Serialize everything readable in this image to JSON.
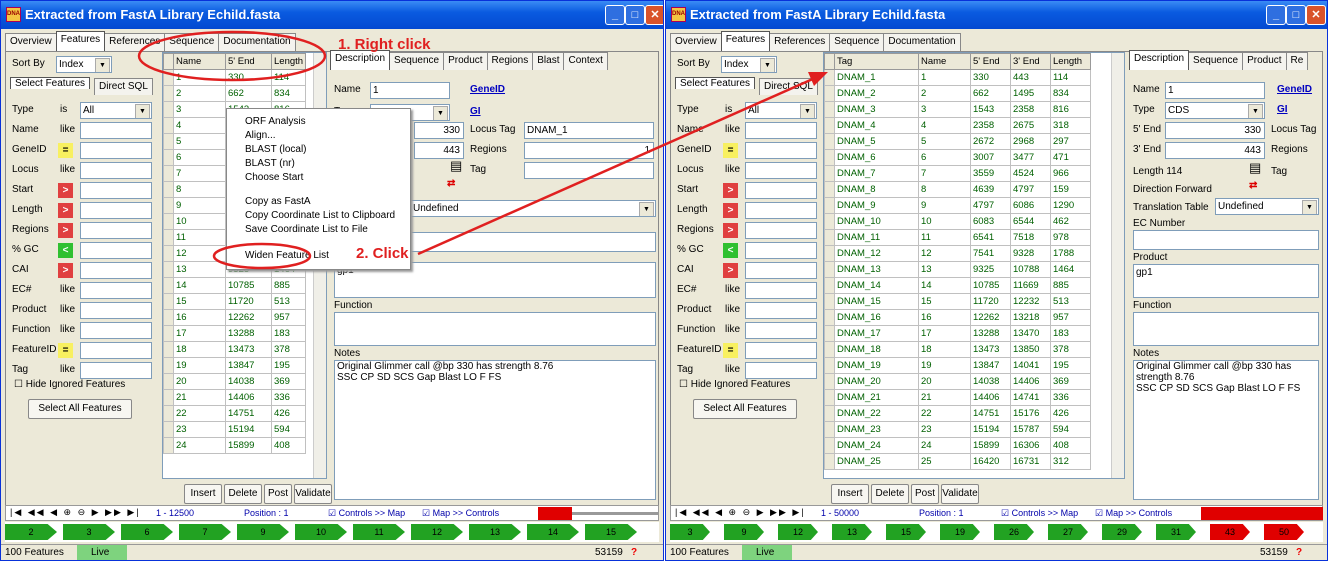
{
  "window_title": "Extracted from FastA Library Echild.fasta",
  "title_icon": "DNA",
  "title_buttons": [
    "_",
    "□",
    "✕"
  ],
  "main_tabs": [
    "Overview",
    "Features",
    "References",
    "Sequence",
    "Documentation"
  ],
  "sort_by": {
    "label": "Sort By",
    "value": "Index"
  },
  "filter_tabs": [
    "Select Features",
    "Direct SQL"
  ],
  "filters": [
    {
      "label": "Type",
      "op_text": "is",
      "value": "All"
    },
    {
      "label": "Name",
      "op_text": "like"
    },
    {
      "label": "GeneID",
      "op_sym": "="
    },
    {
      "label": "Locus",
      "op_text": "like"
    },
    {
      "label": "Start",
      "op_sym": ">"
    },
    {
      "label": "Length",
      "op_sym": ">"
    },
    {
      "label": "Regions",
      "op_sym": ">"
    },
    {
      "label": "% GC",
      "op_sym": "<"
    },
    {
      "label": "CAI",
      "op_sym": ">"
    },
    {
      "label": "EC#",
      "op_text": "like"
    },
    {
      "label": "Product",
      "op_text": "like"
    },
    {
      "label": "Function",
      "op_text": "like"
    },
    {
      "label": "FeatureID",
      "op_sym": "="
    },
    {
      "label": "Tag",
      "op_text": "like"
    }
  ],
  "hide_ignored_label": "Hide Ignored Features",
  "select_all_label": "Select All Features",
  "grid_headers_left": [
    "Name",
    "5' End",
    "Length"
  ],
  "grid_headers_right": [
    "Tag",
    "Name",
    "5' End",
    "3' End",
    "Length"
  ],
  "rows": [
    [
      "DNAM_1",
      "1",
      "330",
      "443",
      "114"
    ],
    [
      "DNAM_2",
      "2",
      "662",
      "1495",
      "834"
    ],
    [
      "DNAM_3",
      "3",
      "1543",
      "2358",
      "816"
    ],
    [
      "DNAM_4",
      "4",
      "2358",
      "2675",
      "318"
    ],
    [
      "DNAM_5",
      "5",
      "2672",
      "2968",
      "297"
    ],
    [
      "DNAM_6",
      "6",
      "3007",
      "3477",
      "471"
    ],
    [
      "DNAM_7",
      "7",
      "3559",
      "4524",
      "966"
    ],
    [
      "DNAM_8",
      "8",
      "4639",
      "4797",
      "159"
    ],
    [
      "DNAM_9",
      "9",
      "4797",
      "6086",
      "1290"
    ],
    [
      "DNAM_10",
      "10",
      "6083",
      "6544",
      "462"
    ],
    [
      "DNAM_11",
      "11",
      "6541",
      "7518",
      "978"
    ],
    [
      "DNAM_12",
      "12",
      "7541",
      "9328",
      "1788"
    ],
    [
      "DNAM_13",
      "13",
      "9325",
      "10788",
      "1464"
    ],
    [
      "DNAM_14",
      "14",
      "10785",
      "11669",
      "885"
    ],
    [
      "DNAM_15",
      "15",
      "11720",
      "12232",
      "513"
    ],
    [
      "DNAM_16",
      "16",
      "12262",
      "13218",
      "957"
    ],
    [
      "DNAM_17",
      "17",
      "13288",
      "13470",
      "183"
    ],
    [
      "DNAM_18",
      "18",
      "13473",
      "13850",
      "378"
    ],
    [
      "DNAM_19",
      "19",
      "13847",
      "14041",
      "195"
    ],
    [
      "DNAM_20",
      "20",
      "14038",
      "14406",
      "369"
    ],
    [
      "DNAM_21",
      "21",
      "14406",
      "14741",
      "336"
    ],
    [
      "DNAM_22",
      "22",
      "14751",
      "15176",
      "426"
    ],
    [
      "DNAM_23",
      "23",
      "15194",
      "15787",
      "594"
    ],
    [
      "DNAM_24",
      "24",
      "15899",
      "16306",
      "408"
    ],
    [
      "DNAM_25",
      "25",
      "16420",
      "16731",
      "312"
    ]
  ],
  "detail_tabs_left": [
    "Description",
    "Sequence",
    "Product",
    "Regions",
    "Blast",
    "Context"
  ],
  "detail_tabs_right": [
    "Description",
    "Sequence",
    "Product",
    "Re"
  ],
  "detail": {
    "name_label": "Name",
    "name_value": "1",
    "type_label": "Type",
    "type_value": "CDS",
    "geneid_link": "GeneID",
    "gi_link": "GI",
    "five_label": "5' End",
    "five_value": "330",
    "three_label": "3' End",
    "three_value": "443",
    "locus_tag_label": "Locus Tag",
    "locus_tag_value": "DNAM_1",
    "regions_label": "Regions",
    "regions_value": "1",
    "tag_label": "Tag",
    "length_text": "Length  114",
    "direction_text": "Direction Forward",
    "translation_label": "Translation Table",
    "translation_value": "Undefined",
    "ec_label": "EC Number",
    "product_label": "Product",
    "product_value": "gp1",
    "function_label": "Function",
    "notes_label": "Notes",
    "notes_line1": "Original Glimmer call @bp 330 has strength 8.76",
    "notes_line2": "SSC  CP  SD  SCS  Gap  Blast  LO  F  FS"
  },
  "context_menu": [
    "ORF Analysis",
    "Align...",
    "BLAST (local)",
    "BLAST (nr)",
    "Choose Start",
    "Copy as FastA",
    "Copy Coordinate List to Clipboard",
    "Save Coordinate List to File",
    "Widen Feature List"
  ],
  "grid_buttons": [
    "Insert",
    "Delete",
    "Post",
    "Validate"
  ],
  "nav_left": {
    "range": "1 - 12500",
    "position": "Position : 1"
  },
  "nav_right": {
    "range": "1 - 50000",
    "position": "Position : 1"
  },
  "nav_checks": [
    "Controls >> Map",
    "Map >> Controls"
  ],
  "map_labels_left": [
    "2",
    "3",
    "6",
    "7",
    "9",
    "10",
    "11",
    "12",
    "13",
    "14",
    "15"
  ],
  "map_labels_right": [
    "3",
    "9",
    "12",
    "13",
    "15",
    "19",
    "26",
    "27",
    "29",
    "31",
    "43",
    "50"
  ],
  "status": {
    "features": "100 Features",
    "mode": "Live",
    "count": "53159"
  },
  "annotations": {
    "right_click": "1. Right click",
    "click": "2. Click"
  },
  "colors": {
    "title_blue": "#0a5be0",
    "gene_green": "#22a222",
    "annotation_red": "#e02020"
  }
}
